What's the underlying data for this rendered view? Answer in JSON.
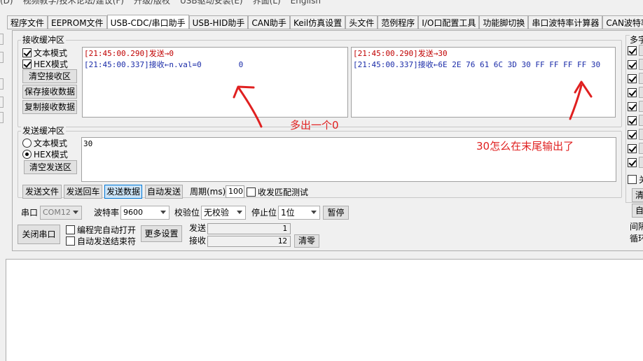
{
  "menu": [
    "(D)",
    "视频教学/技术论坛/建议(F)",
    "升级/版权",
    "USB驱动安装(E)",
    "界面(L)",
    "English"
  ],
  "tabs": [
    {
      "label": "程序文件",
      "active": false
    },
    {
      "label": "EEPROM文件",
      "active": false
    },
    {
      "label": "USB-CDC/串口助手",
      "active": true
    },
    {
      "label": "USB-HID助手",
      "active": false
    },
    {
      "label": "CAN助手",
      "active": false
    },
    {
      "label": "Keil仿真设置",
      "active": false
    },
    {
      "label": "头文件",
      "active": false
    },
    {
      "label": "范例程序",
      "active": false
    },
    {
      "label": "I/O口配置工具",
      "active": false
    },
    {
      "label": "功能脚切换",
      "active": false
    },
    {
      "label": "串口波特率计算器",
      "active": false
    },
    {
      "label": "CAN波特率计算",
      "active": false
    }
  ],
  "receive": {
    "title": "接收缓冲区",
    "text_mode": "文本模式",
    "hex_mode": "HEX模式",
    "clear_btn": "清空接收区",
    "save_btn": "保存接收数据",
    "copy_btn": "复制接收数据",
    "left_lines": [
      {
        "kind": "sent",
        "text": "[21:45:00.290]发送→0"
      },
      {
        "kind": "recv",
        "text": "[21:45:00.337]接收←n.val=0        0"
      }
    ],
    "right_lines": [
      {
        "kind": "sent",
        "text": "[21:45:00.290]发送→30"
      },
      {
        "kind": "recv",
        "text": "[21:45:00.337]接收←6E 2E 76 61 6C 3D 30 FF FF FF FF 30"
      }
    ]
  },
  "send": {
    "title": "发送缓冲区",
    "text_mode": "文本模式",
    "hex_mode": "HEX模式",
    "clear_btn": "清空发送区",
    "content": "30",
    "send_file_btn": "发送文件",
    "send_enter_btn": "发送回车",
    "send_data_btn": "发送数据",
    "auto_send_btn": "自动发送",
    "period_label": "周期(ms)",
    "period_value": "100",
    "match_test": "收发匹配测试"
  },
  "port": {
    "port_label": "串口",
    "port_value": "COM12",
    "baud_label": "波特率",
    "baud_value": "9600",
    "parity_label": "校验位",
    "parity_value": "无校验",
    "stop_label": "停止位",
    "stop_value": "1位",
    "pause_btn": "暂停",
    "close_btn": "关闭串口",
    "auto_open": "编程完自动打开",
    "auto_end": "自动发送结束符",
    "more_btn": "更多设置",
    "sent_label": "发送",
    "sent_count": "1",
    "recv_label": "接收",
    "recv_count": "12",
    "clear_count_btn": "清零"
  },
  "right_panel": {
    "title": "多字",
    "bottom1": "间隔",
    "bottom2": "循环",
    "btn1": "清",
    "btn2": "自",
    "cb_label": "关"
  },
  "annotations": {
    "extra_zero": "多出一个0",
    "trailing_30": "30怎么在末尾输出了",
    "color": "#e02020"
  }
}
